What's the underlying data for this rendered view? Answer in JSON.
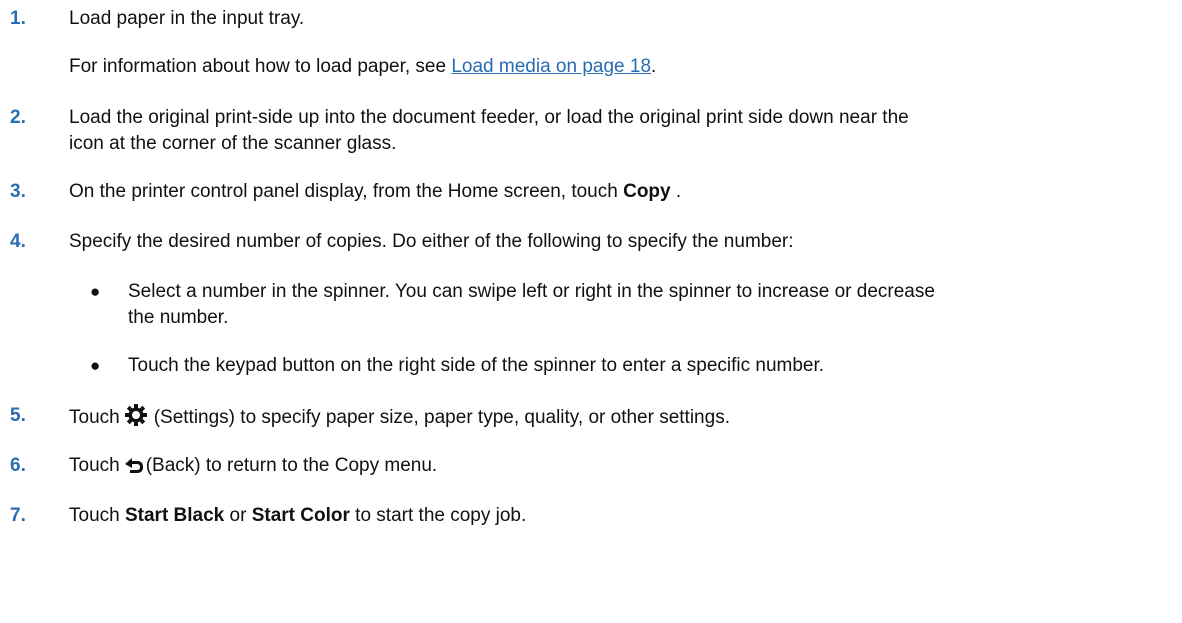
{
  "steps": {
    "s1": {
      "num": "1.",
      "text": "Load paper in the input tray."
    },
    "s1_info": {
      "prefix": "For information about how to load paper, see ",
      "link": "Load media on page 18",
      "suffix": "."
    },
    "s2": {
      "num": "2.",
      "line1": "Load the original print-side up into the document feeder, or load the original print side down near the",
      "line2": "icon at the corner of the scanner glass."
    },
    "s3": {
      "num": "3.",
      "prefix": "On the printer control panel display, from the Home screen, touch ",
      "bold": "Copy",
      "suffix": " ."
    },
    "s4": {
      "num": "4.",
      "text": "Specify the desired number of copies. Do either of the following to specify the number:"
    },
    "b1": {
      "dot": "●",
      "line1": "Select a number in the spinner. You can swipe left or right in the spinner to increase or decrease",
      "line2": "the number."
    },
    "b2": {
      "dot": "●",
      "text": "Touch the keypad button on the right side of the spinner to enter a specific number."
    },
    "s5": {
      "num": "5.",
      "touch": "Touch",
      "rest": "(Settings) to specify paper size, paper type, quality, or other settings.",
      "icon": "gear-icon"
    },
    "s6": {
      "num": "6.",
      "touch": "Touch",
      "rest": "(Back) to return to the Copy menu.",
      "icon": "back-icon"
    },
    "s7": {
      "num": "7.",
      "touch": "Touch ",
      "bold1": "Start Black",
      "mid": " or ",
      "bold2": "Start Color",
      "suffix": " to start the copy job."
    }
  }
}
